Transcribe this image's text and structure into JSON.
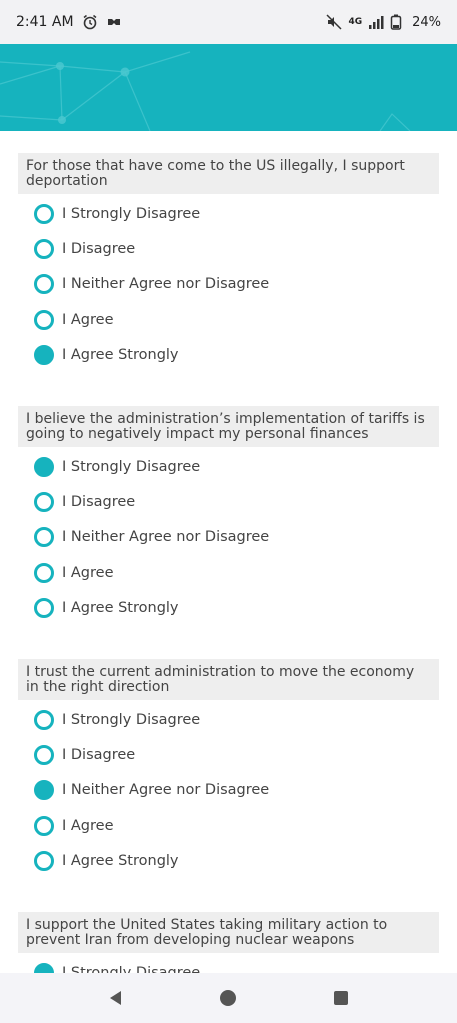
{
  "status_bar": {
    "time": "2:41 AM",
    "network": "4G",
    "battery": "24%"
  },
  "colors": {
    "accent": "#16b3be",
    "question_bg": "#eeeeee"
  },
  "questions": [
    {
      "text": "For those that have come to the US illegally, I support deportation",
      "options": [
        {
          "label": "I Strongly Disagree",
          "selected": false
        },
        {
          "label": "I Disagree",
          "selected": false
        },
        {
          "label": "I Neither Agree nor Disagree",
          "selected": false
        },
        {
          "label": "I Agree",
          "selected": false
        },
        {
          "label": "I Agree Strongly",
          "selected": true
        }
      ]
    },
    {
      "text": "I believe the administration’s implementation of tariffs is going to negatively impact my personal finances",
      "options": [
        {
          "label": "I Strongly Disagree",
          "selected": true
        },
        {
          "label": "I Disagree",
          "selected": false
        },
        {
          "label": "I Neither Agree nor Disagree",
          "selected": false
        },
        {
          "label": "I Agree",
          "selected": false
        },
        {
          "label": "I Agree Strongly",
          "selected": false
        }
      ]
    },
    {
      "text": "I trust the current administration to move the economy in the right direction",
      "options": [
        {
          "label": "I Strongly Disagree",
          "selected": false
        },
        {
          "label": "I Disagree",
          "selected": false
        },
        {
          "label": "I Neither Agree nor Disagree",
          "selected": true
        },
        {
          "label": "I Agree",
          "selected": false
        },
        {
          "label": "I Agree Strongly",
          "selected": false
        }
      ]
    },
    {
      "text": "I support the United States taking military action to prevent Iran from developing nuclear weapons",
      "options": [
        {
          "label": "I Strongly Disagree",
          "selected": true
        }
      ]
    }
  ]
}
